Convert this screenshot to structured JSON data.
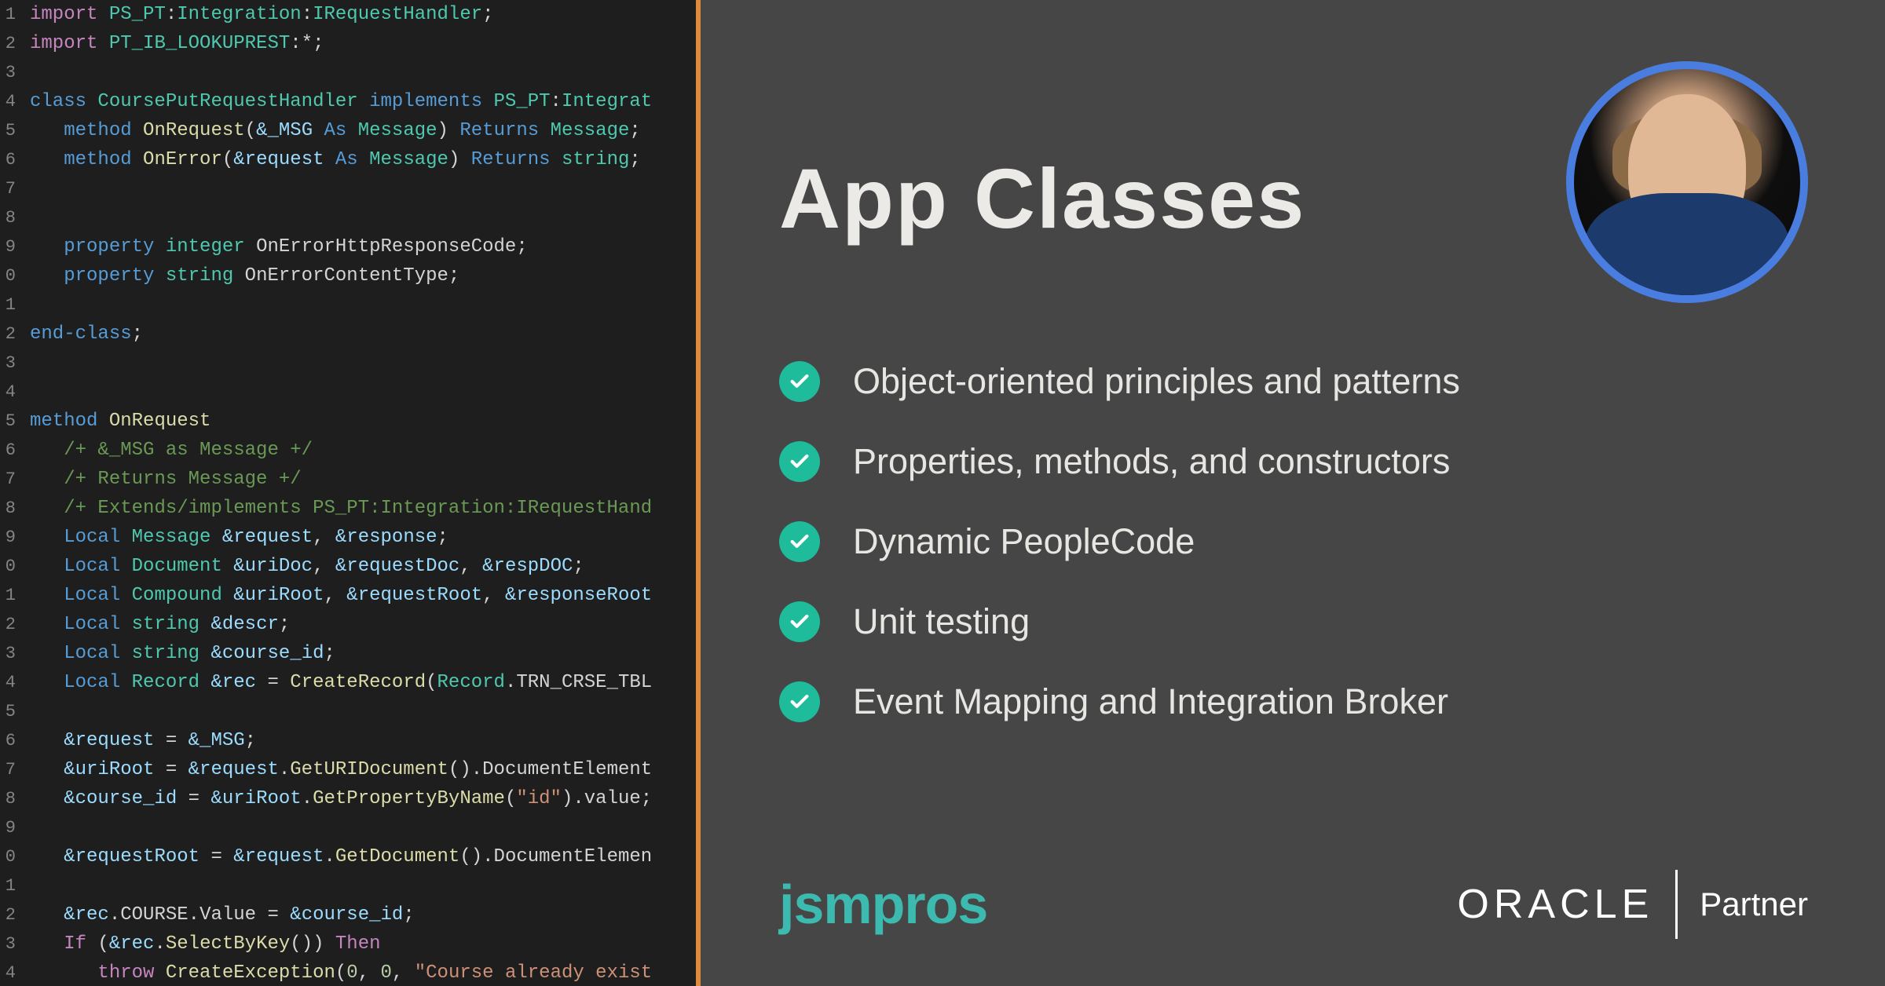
{
  "code": {
    "lines": [
      {
        "n": "1",
        "tokens": [
          {
            "c": "kw-import",
            "t": "import"
          },
          {
            "c": "punct",
            "t": " "
          },
          {
            "c": "type",
            "t": "PS_PT"
          },
          {
            "c": "punct",
            "t": ":"
          },
          {
            "c": "type",
            "t": "Integration"
          },
          {
            "c": "punct",
            "t": ":"
          },
          {
            "c": "type",
            "t": "IRequestHandler"
          },
          {
            "c": "punct",
            "t": ";"
          }
        ]
      },
      {
        "n": "2",
        "tokens": [
          {
            "c": "kw-import",
            "t": "import"
          },
          {
            "c": "punct",
            "t": " "
          },
          {
            "c": "type",
            "t": "PT_IB_LOOKUPREST"
          },
          {
            "c": "punct",
            "t": ":*;"
          }
        ]
      },
      {
        "n": "3",
        "tokens": []
      },
      {
        "n": "4",
        "tokens": [
          {
            "c": "kw-class",
            "t": "class"
          },
          {
            "c": "punct",
            "t": " "
          },
          {
            "c": "type",
            "t": "CoursePutRequestHandler"
          },
          {
            "c": "punct",
            "t": " "
          },
          {
            "c": "implements",
            "t": "implements"
          },
          {
            "c": "punct",
            "t": " "
          },
          {
            "c": "type",
            "t": "PS_PT"
          },
          {
            "c": "punct",
            "t": ":"
          },
          {
            "c": "type",
            "t": "Integrat"
          }
        ]
      },
      {
        "n": "5",
        "tokens": [
          {
            "c": "punct",
            "t": "   "
          },
          {
            "c": "kw-method",
            "t": "method"
          },
          {
            "c": "punct",
            "t": " "
          },
          {
            "c": "func",
            "t": "OnRequest"
          },
          {
            "c": "punct",
            "t": "("
          },
          {
            "c": "var",
            "t": "&_MSG"
          },
          {
            "c": "punct",
            "t": " "
          },
          {
            "c": "kw-as",
            "t": "As"
          },
          {
            "c": "punct",
            "t": " "
          },
          {
            "c": "type",
            "t": "Message"
          },
          {
            "c": "punct",
            "t": ") "
          },
          {
            "c": "kw-returns",
            "t": "Returns"
          },
          {
            "c": "punct",
            "t": " "
          },
          {
            "c": "type",
            "t": "Message"
          },
          {
            "c": "punct",
            "t": ";"
          }
        ]
      },
      {
        "n": "6",
        "tokens": [
          {
            "c": "punct",
            "t": "   "
          },
          {
            "c": "kw-method",
            "t": "method"
          },
          {
            "c": "punct",
            "t": " "
          },
          {
            "c": "func",
            "t": "OnError"
          },
          {
            "c": "punct",
            "t": "("
          },
          {
            "c": "var",
            "t": "&request"
          },
          {
            "c": "punct",
            "t": " "
          },
          {
            "c": "kw-as",
            "t": "As"
          },
          {
            "c": "punct",
            "t": " "
          },
          {
            "c": "type",
            "t": "Message"
          },
          {
            "c": "punct",
            "t": ") "
          },
          {
            "c": "kw-returns",
            "t": "Returns"
          },
          {
            "c": "punct",
            "t": " "
          },
          {
            "c": "type",
            "t": "string"
          },
          {
            "c": "punct",
            "t": ";"
          }
        ]
      },
      {
        "n": "7",
        "tokens": []
      },
      {
        "n": "8",
        "tokens": []
      },
      {
        "n": "9",
        "tokens": [
          {
            "c": "punct",
            "t": "   "
          },
          {
            "c": "kw-property",
            "t": "property"
          },
          {
            "c": "punct",
            "t": " "
          },
          {
            "c": "type",
            "t": "integer"
          },
          {
            "c": "punct",
            "t": " "
          },
          {
            "c": "ident",
            "t": "OnErrorHttpResponseCode"
          },
          {
            "c": "punct",
            "t": ";"
          }
        ]
      },
      {
        "n": "0",
        "tokens": [
          {
            "c": "punct",
            "t": "   "
          },
          {
            "c": "kw-property",
            "t": "property"
          },
          {
            "c": "punct",
            "t": " "
          },
          {
            "c": "type",
            "t": "string"
          },
          {
            "c": "punct",
            "t": " "
          },
          {
            "c": "ident",
            "t": "OnErrorContentType"
          },
          {
            "c": "punct",
            "t": ";"
          }
        ]
      },
      {
        "n": "1",
        "tokens": []
      },
      {
        "n": "2",
        "tokens": [
          {
            "c": "kw-end",
            "t": "end-class"
          },
          {
            "c": "punct",
            "t": ";"
          }
        ]
      },
      {
        "n": "3",
        "tokens": []
      },
      {
        "n": "4",
        "tokens": []
      },
      {
        "n": "5",
        "tokens": [
          {
            "c": "kw-method",
            "t": "method"
          },
          {
            "c": "punct",
            "t": " "
          },
          {
            "c": "func",
            "t": "OnRequest"
          }
        ]
      },
      {
        "n": "6",
        "tokens": [
          {
            "c": "punct",
            "t": "   "
          },
          {
            "c": "cmt",
            "t": "/+ &_MSG as Message +/"
          }
        ]
      },
      {
        "n": "7",
        "tokens": [
          {
            "c": "punct",
            "t": "   "
          },
          {
            "c": "cmt",
            "t": "/+ Returns Message +/"
          }
        ]
      },
      {
        "n": "8",
        "tokens": [
          {
            "c": "punct",
            "t": "   "
          },
          {
            "c": "cmt",
            "t": "/+ Extends/implements PS_PT:Integration:IRequestHand"
          }
        ]
      },
      {
        "n": "9",
        "tokens": [
          {
            "c": "punct",
            "t": "   "
          },
          {
            "c": "kw-local",
            "t": "Local"
          },
          {
            "c": "punct",
            "t": " "
          },
          {
            "c": "type",
            "t": "Message"
          },
          {
            "c": "punct",
            "t": " "
          },
          {
            "c": "var",
            "t": "&request"
          },
          {
            "c": "punct",
            "t": ", "
          },
          {
            "c": "var",
            "t": "&response"
          },
          {
            "c": "punct",
            "t": ";"
          }
        ]
      },
      {
        "n": "0",
        "tokens": [
          {
            "c": "punct",
            "t": "   "
          },
          {
            "c": "kw-local",
            "t": "Local"
          },
          {
            "c": "punct",
            "t": " "
          },
          {
            "c": "type",
            "t": "Document"
          },
          {
            "c": "punct",
            "t": " "
          },
          {
            "c": "var",
            "t": "&uriDoc"
          },
          {
            "c": "punct",
            "t": ", "
          },
          {
            "c": "var",
            "t": "&requestDoc"
          },
          {
            "c": "punct",
            "t": ", "
          },
          {
            "c": "var",
            "t": "&respDOC"
          },
          {
            "c": "punct",
            "t": ";"
          }
        ]
      },
      {
        "n": "1",
        "tokens": [
          {
            "c": "punct",
            "t": "   "
          },
          {
            "c": "kw-local",
            "t": "Local"
          },
          {
            "c": "punct",
            "t": " "
          },
          {
            "c": "type",
            "t": "Compound"
          },
          {
            "c": "punct",
            "t": " "
          },
          {
            "c": "var",
            "t": "&uriRoot"
          },
          {
            "c": "punct",
            "t": ", "
          },
          {
            "c": "var",
            "t": "&requestRoot"
          },
          {
            "c": "punct",
            "t": ", "
          },
          {
            "c": "var",
            "t": "&responseRoot"
          }
        ]
      },
      {
        "n": "2",
        "tokens": [
          {
            "c": "punct",
            "t": "   "
          },
          {
            "c": "kw-local",
            "t": "Local"
          },
          {
            "c": "punct",
            "t": " "
          },
          {
            "c": "type",
            "t": "string"
          },
          {
            "c": "punct",
            "t": " "
          },
          {
            "c": "var",
            "t": "&descr"
          },
          {
            "c": "punct",
            "t": ";"
          }
        ]
      },
      {
        "n": "3",
        "tokens": [
          {
            "c": "punct",
            "t": "   "
          },
          {
            "c": "kw-local",
            "t": "Local"
          },
          {
            "c": "punct",
            "t": " "
          },
          {
            "c": "type",
            "t": "string"
          },
          {
            "c": "punct",
            "t": " "
          },
          {
            "c": "var",
            "t": "&course_id"
          },
          {
            "c": "punct",
            "t": ";"
          }
        ]
      },
      {
        "n": "4",
        "tokens": [
          {
            "c": "punct",
            "t": "   "
          },
          {
            "c": "kw-local",
            "t": "Local"
          },
          {
            "c": "punct",
            "t": " "
          },
          {
            "c": "type",
            "t": "Record"
          },
          {
            "c": "punct",
            "t": " "
          },
          {
            "c": "var",
            "t": "&rec"
          },
          {
            "c": "punct",
            "t": " = "
          },
          {
            "c": "func",
            "t": "CreateRecord"
          },
          {
            "c": "punct",
            "t": "("
          },
          {
            "c": "type",
            "t": "Record"
          },
          {
            "c": "punct",
            "t": "."
          },
          {
            "c": "ident",
            "t": "TRN_CRSE_TBL"
          }
        ]
      },
      {
        "n": "5",
        "tokens": []
      },
      {
        "n": "6",
        "tokens": [
          {
            "c": "punct",
            "t": "   "
          },
          {
            "c": "var",
            "t": "&request"
          },
          {
            "c": "punct",
            "t": " = "
          },
          {
            "c": "var",
            "t": "&_MSG"
          },
          {
            "c": "punct",
            "t": ";"
          }
        ]
      },
      {
        "n": "7",
        "tokens": [
          {
            "c": "punct",
            "t": "   "
          },
          {
            "c": "var",
            "t": "&uriRoot"
          },
          {
            "c": "punct",
            "t": " = "
          },
          {
            "c": "var",
            "t": "&request"
          },
          {
            "c": "punct",
            "t": "."
          },
          {
            "c": "func",
            "t": "GetURIDocument"
          },
          {
            "c": "punct",
            "t": "()."
          },
          {
            "c": "ident",
            "t": "DocumentElement"
          }
        ]
      },
      {
        "n": "8",
        "tokens": [
          {
            "c": "punct",
            "t": "   "
          },
          {
            "c": "var",
            "t": "&course_id"
          },
          {
            "c": "punct",
            "t": " = "
          },
          {
            "c": "var",
            "t": "&uriRoot"
          },
          {
            "c": "punct",
            "t": "."
          },
          {
            "c": "func",
            "t": "GetPropertyByName"
          },
          {
            "c": "punct",
            "t": "("
          },
          {
            "c": "str",
            "t": "\"id\""
          },
          {
            "c": "punct",
            "t": ")."
          },
          {
            "c": "ident",
            "t": "value"
          },
          {
            "c": "punct",
            "t": ";"
          }
        ]
      },
      {
        "n": "9",
        "tokens": []
      },
      {
        "n": "0",
        "tokens": [
          {
            "c": "punct",
            "t": "   "
          },
          {
            "c": "var",
            "t": "&requestRoot"
          },
          {
            "c": "punct",
            "t": " = "
          },
          {
            "c": "var",
            "t": "&request"
          },
          {
            "c": "punct",
            "t": "."
          },
          {
            "c": "func",
            "t": "GetDocument"
          },
          {
            "c": "punct",
            "t": "()."
          },
          {
            "c": "ident",
            "t": "DocumentElemen"
          }
        ]
      },
      {
        "n": "1",
        "tokens": []
      },
      {
        "n": "2",
        "tokens": [
          {
            "c": "punct",
            "t": "   "
          },
          {
            "c": "var",
            "t": "&rec"
          },
          {
            "c": "punct",
            "t": "."
          },
          {
            "c": "ident",
            "t": "COURSE"
          },
          {
            "c": "punct",
            "t": "."
          },
          {
            "c": "ident",
            "t": "Value"
          },
          {
            "c": "punct",
            "t": " = "
          },
          {
            "c": "var",
            "t": "&course_id"
          },
          {
            "c": "punct",
            "t": ";"
          }
        ]
      },
      {
        "n": "3",
        "tokens": [
          {
            "c": "punct",
            "t": "   "
          },
          {
            "c": "kw-if",
            "t": "If"
          },
          {
            "c": "punct",
            "t": " ("
          },
          {
            "c": "var",
            "t": "&rec"
          },
          {
            "c": "punct",
            "t": "."
          },
          {
            "c": "func",
            "t": "SelectByKey"
          },
          {
            "c": "punct",
            "t": "()) "
          },
          {
            "c": "kw-then",
            "t": "Then"
          }
        ]
      },
      {
        "n": "4",
        "tokens": [
          {
            "c": "punct",
            "t": "      "
          },
          {
            "c": "kw-throw",
            "t": "throw"
          },
          {
            "c": "punct",
            "t": " "
          },
          {
            "c": "func",
            "t": "CreateException"
          },
          {
            "c": "punct",
            "t": "("
          },
          {
            "c": "num",
            "t": "0"
          },
          {
            "c": "punct",
            "t": ", "
          },
          {
            "c": "num",
            "t": "0"
          },
          {
            "c": "punct",
            "t": ", "
          },
          {
            "c": "str",
            "t": "\"Course already exist"
          }
        ]
      }
    ]
  },
  "right": {
    "title": "App Classes",
    "bullets": [
      "Object-oriented principles and patterns",
      "Properties, methods, and constructors",
      "Dynamic PeopleCode",
      "Unit testing",
      "Event Mapping and Integration Broker"
    ],
    "jsmpros": "jsmpros",
    "oracle": "ORACLE",
    "partner": "Partner"
  }
}
